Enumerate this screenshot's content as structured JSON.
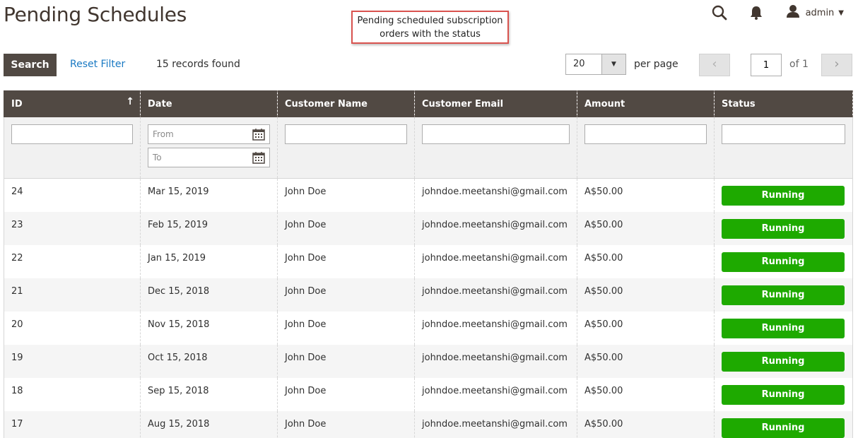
{
  "page": {
    "title": "Pending Schedules"
  },
  "callout": {
    "line1": "Pending scheduled subscription",
    "line2": "orders with the status"
  },
  "header": {
    "user_name": "admin"
  },
  "toolbar": {
    "search_label": "Search",
    "reset_label": "Reset Filter",
    "records_text": "15 records found",
    "per_page_value": "20",
    "per_page_label": "per page",
    "page_current": "1",
    "page_of": "of 1"
  },
  "columns": [
    "ID",
    "Date",
    "Customer Name",
    "Customer Email",
    "Amount",
    "Status"
  ],
  "filters": {
    "date_from_placeholder": "From",
    "date_to_placeholder": "To"
  },
  "rows": [
    {
      "id": "24",
      "date": "Mar 15, 2019",
      "name": "John Doe",
      "email": "johndoe.meetanshi@gmail.com",
      "amount": "A$50.00",
      "status": "Running"
    },
    {
      "id": "23",
      "date": "Feb 15, 2019",
      "name": "John Doe",
      "email": "johndoe.meetanshi@gmail.com",
      "amount": "A$50.00",
      "status": "Running"
    },
    {
      "id": "22",
      "date": "Jan 15, 2019",
      "name": "John Doe",
      "email": "johndoe.meetanshi@gmail.com",
      "amount": "A$50.00",
      "status": "Running"
    },
    {
      "id": "21",
      "date": "Dec 15, 2018",
      "name": "John Doe",
      "email": "johndoe.meetanshi@gmail.com",
      "amount": "A$50.00",
      "status": "Running"
    },
    {
      "id": "20",
      "date": "Nov 15, 2018",
      "name": "John Doe",
      "email": "johndoe.meetanshi@gmail.com",
      "amount": "A$50.00",
      "status": "Running"
    },
    {
      "id": "19",
      "date": "Oct 15, 2018",
      "name": "John Doe",
      "email": "johndoe.meetanshi@gmail.com",
      "amount": "A$50.00",
      "status": "Running"
    },
    {
      "id": "18",
      "date": "Sep 15, 2018",
      "name": "John Doe",
      "email": "johndoe.meetanshi@gmail.com",
      "amount": "A$50.00",
      "status": "Running"
    },
    {
      "id": "17",
      "date": "Aug 15, 2018",
      "name": "John Doe",
      "email": "johndoe.meetanshi@gmail.com",
      "amount": "A$50.00",
      "status": "Running"
    }
  ],
  "colors": {
    "header_bg": "#514943",
    "status_running": "#1eaa00",
    "link": "#1979c3",
    "callout_border": "#d9534f"
  }
}
